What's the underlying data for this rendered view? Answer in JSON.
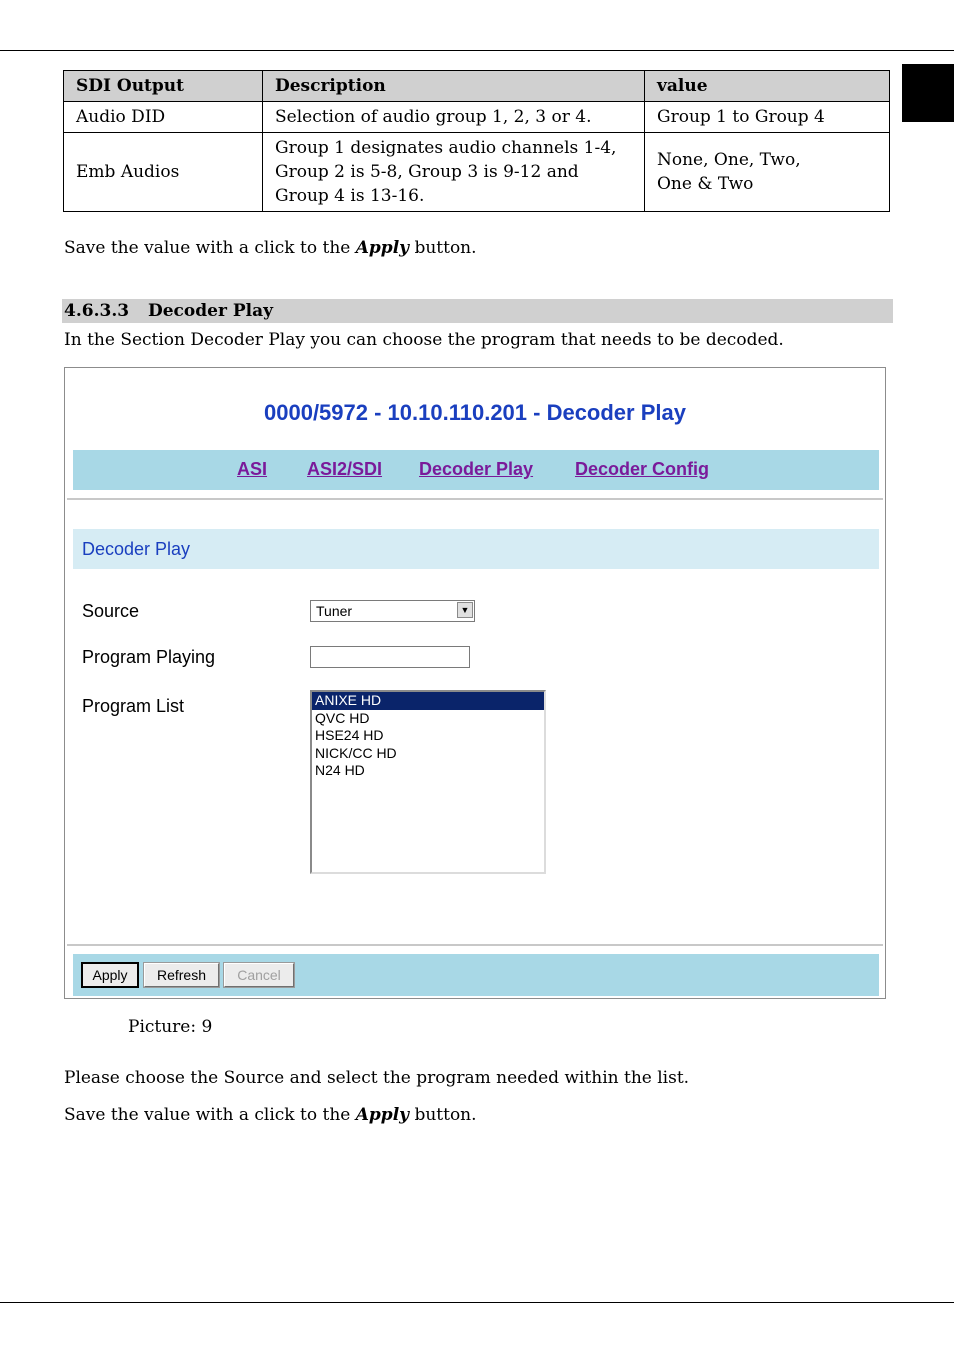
{
  "table": {
    "headers": [
      "SDI Output",
      "Description",
      "value"
    ],
    "rows": [
      {
        "output": "Audio DID",
        "description": [
          "Selection of audio group 1, 2, 3 or 4."
        ],
        "value": [
          "Group 1 to Group 4"
        ]
      },
      {
        "output": "Emb Audios",
        "description": [
          "Group 1 designates audio channels 1-4,",
          "Group 2 is 5-8, Group 3 is 9-12 and",
          "Group 4 is 13-16."
        ],
        "value": [
          "None, One, Two,",
          "One & Two"
        ]
      }
    ]
  },
  "save_note_1": {
    "before": "Save the value with a click to the ",
    "emphasis": "Apply",
    "after": " button."
  },
  "section": {
    "number": "4.6.3.3",
    "title": "Decoder Play"
  },
  "intro": "In the Section Decoder Play you can choose the program that needs to be decoded.",
  "screenshot": {
    "title": "0000/5972 - 10.10.110.201 - Decoder Play",
    "nav": [
      "ASI",
      "ASI2/SDI",
      "Decoder Play",
      "Decoder Config"
    ],
    "section_title": "Decoder Play",
    "source_label": "Source",
    "source_value": "Tuner",
    "program_playing_label": "Program Playing",
    "program_playing_value": "",
    "program_list_label": "Program List",
    "program_list": [
      "ANIXE HD",
      "QVC HD",
      "HSE24 HD",
      "NICK/CC HD",
      "N24 HD"
    ],
    "selected_program": "ANIXE HD",
    "buttons": {
      "apply": "Apply",
      "refresh": "Refresh",
      "cancel": "Cancel"
    }
  },
  "caption": "Picture:  9",
  "choose_note": "Please choose the Source and select the program needed within the list.",
  "save_note_2": {
    "before": "Save the value with a click to the ",
    "emphasis": "Apply",
    "after": " button."
  }
}
